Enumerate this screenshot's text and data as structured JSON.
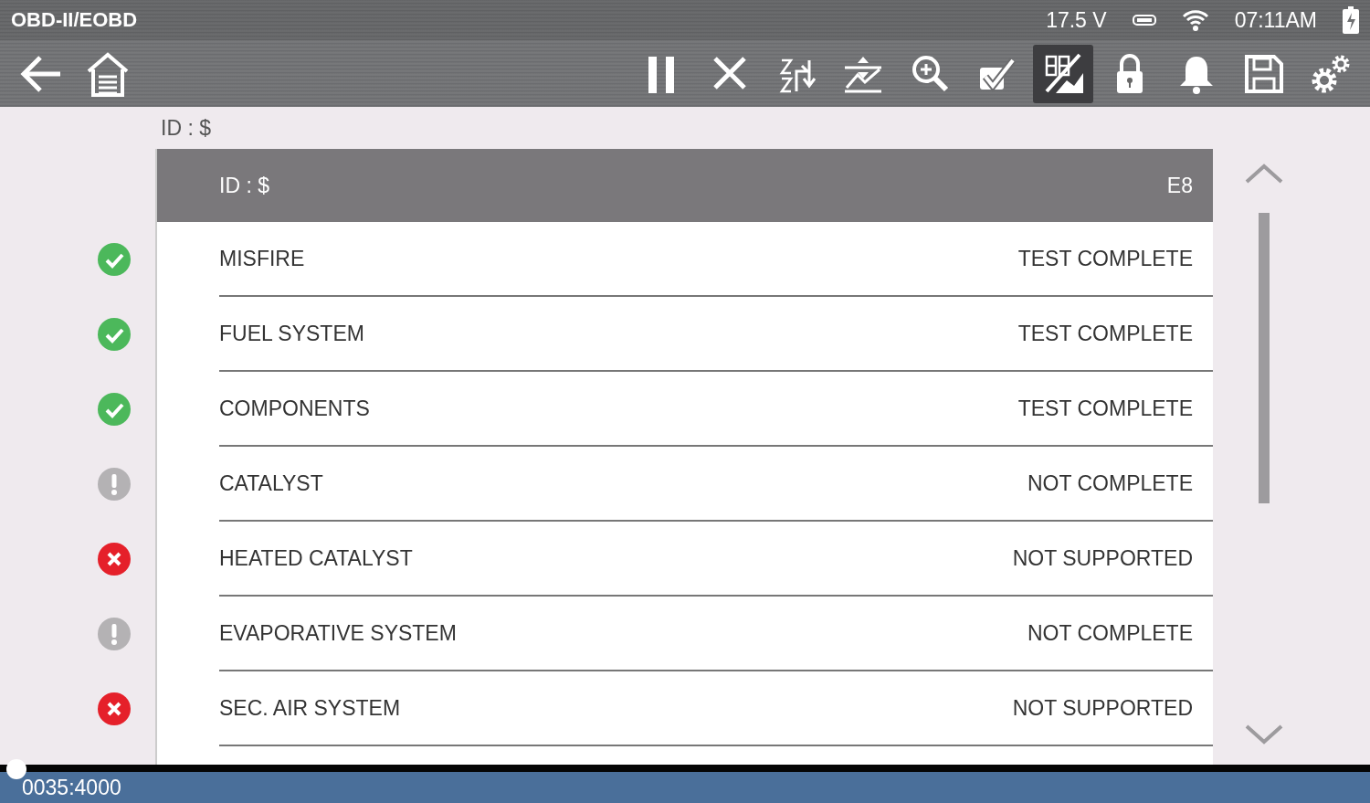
{
  "status_bar": {
    "title": "OBD-II/EOBD",
    "voltage": "17.5 V",
    "time": "07:11AM"
  },
  "toolbar": {
    "tools": [
      {
        "kind": "pause",
        "selected": false
      },
      {
        "kind": "clear",
        "selected": false
      },
      {
        "kind": "sort",
        "selected": false
      },
      {
        "kind": "graph",
        "selected": false
      },
      {
        "kind": "zoom",
        "selected": false
      },
      {
        "kind": "check",
        "selected": false
      },
      {
        "kind": "digital",
        "selected": true
      },
      {
        "kind": "lock",
        "selected": false
      },
      {
        "kind": "bell",
        "selected": false
      },
      {
        "kind": "save",
        "selected": false
      },
      {
        "kind": "settings",
        "selected": false
      }
    ]
  },
  "caption": "ID : $",
  "table": {
    "header": {
      "label": "ID : $",
      "value": "E8"
    },
    "rows": [
      {
        "kind": "complete",
        "name": "MISFIRE",
        "value": "TEST COMPLETE"
      },
      {
        "kind": "complete",
        "name": "FUEL SYSTEM",
        "value": "TEST COMPLETE"
      },
      {
        "kind": "complete",
        "name": "COMPONENTS",
        "value": "TEST COMPLETE"
      },
      {
        "kind": "incomplete",
        "name": "CATALYST",
        "value": "NOT COMPLETE"
      },
      {
        "kind": "unsupported",
        "name": "HEATED CATALYST",
        "value": "NOT SUPPORTED"
      },
      {
        "kind": "incomplete",
        "name": "EVAPORATIVE SYSTEM",
        "value": "NOT COMPLETE"
      },
      {
        "kind": "unsupported",
        "name": "SEC. AIR SYSTEM",
        "value": "NOT SUPPORTED"
      }
    ]
  },
  "footer": {
    "counter": "0035:4000",
    "level": 0
  }
}
